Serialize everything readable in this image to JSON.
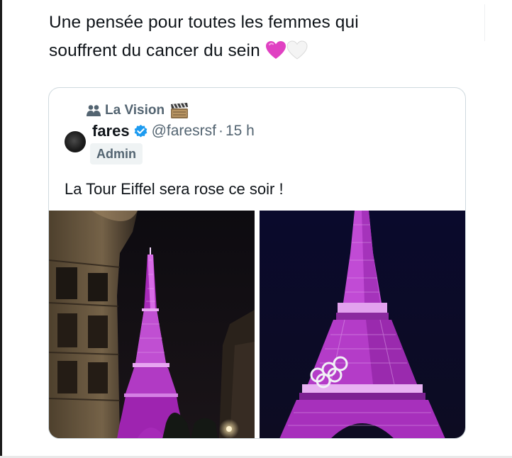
{
  "post": {
    "text_line1": "Une pensée pour toutes les femmes qui",
    "text_line2": "souffrent du cancer du sein",
    "emojis": [
      "pink-heart",
      "white-heart"
    ]
  },
  "quote": {
    "community_name": "La Vision",
    "community_emoji": "clapper-board",
    "author_name": "fares",
    "verified": true,
    "handle": "@faresrsf",
    "separator": "·",
    "time": "15 h",
    "badge": "Admin",
    "text": "La Tour Eiffel sera rose ce soir !",
    "media": [
      {
        "subject": "pink-illuminated-eiffel-tower-street-view"
      },
      {
        "subject": "pink-illuminated-eiffel-tower-olympic-rings"
      }
    ]
  },
  "colors": {
    "text_primary": "#0f1419",
    "text_secondary": "#536471",
    "border": "#cfd9de",
    "verified_blue": "#1d9bf0",
    "tower_pink": "#b72fc4"
  }
}
